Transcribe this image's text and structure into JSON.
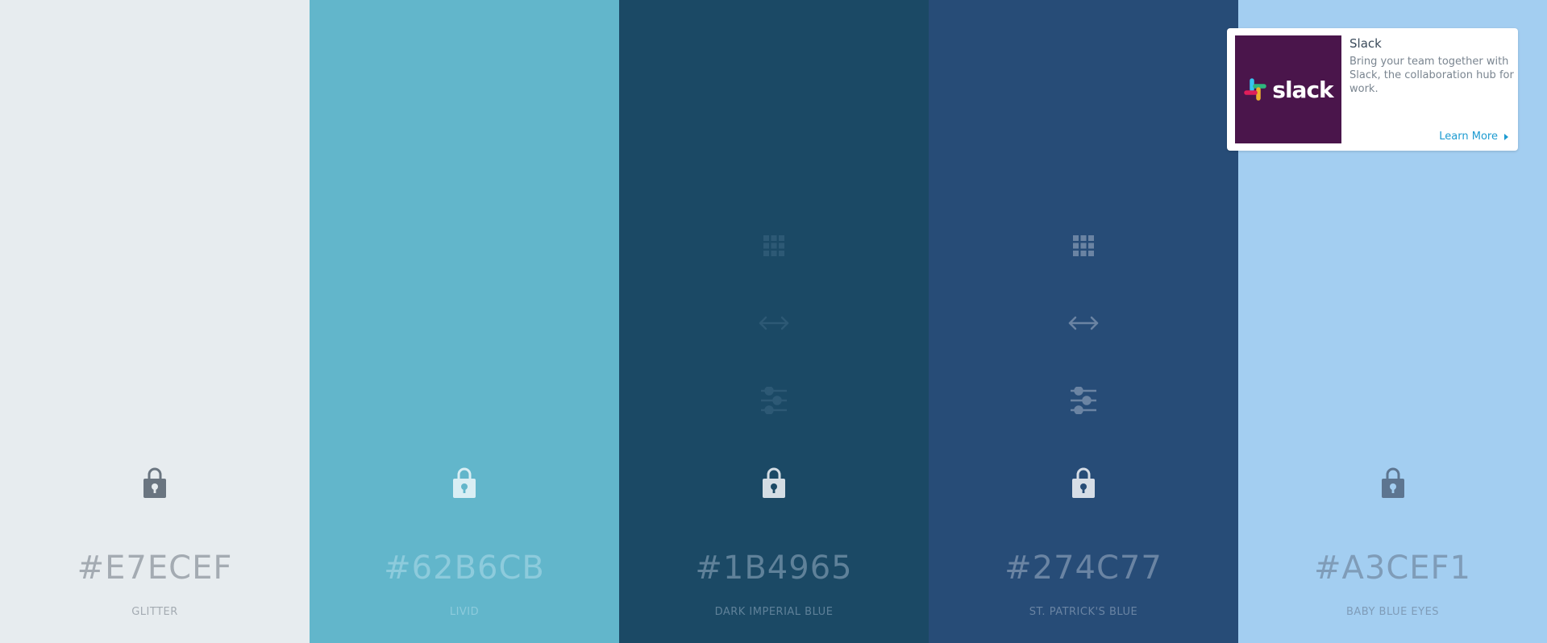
{
  "swatches": [
    {
      "hex": "#E7ECEF",
      "name": "GLITTER",
      "bg": "#e7ecef",
      "text_color": "#a4abb2",
      "lock_color": "#6a7580",
      "tools_visible": false
    },
    {
      "hex": "#62B6CB",
      "name": "LIVID",
      "bg": "#62b6cb",
      "text_color": "#8dcbdc",
      "lock_color": "#d9eef4",
      "tools_visible": false
    },
    {
      "hex": "#1B4965",
      "name": "DARK IMPERIAL BLUE",
      "bg": "#1b4965",
      "text_color": "#5f8199",
      "lock_color": "#d4dde4",
      "tools_visible": true,
      "tool_color": "#2d5975"
    },
    {
      "hex": "#274C77",
      "name": "ST. PATRICK'S BLUE",
      "bg": "#274c77",
      "text_color": "#6a84a3",
      "lock_color": "#d6dde6",
      "tools_visible": true,
      "tool_color": "#6b84a3"
    },
    {
      "hex": "#A3CEF1",
      "name": "BABY BLUE EYES",
      "bg": "#a3cef1",
      "text_color": "#7f9cb8",
      "lock_color": "#5d7590",
      "tools_visible": false
    }
  ],
  "icons": {
    "grid": "grid-icon",
    "drag": "drag-arrows-icon",
    "adjust": "adjust-sliders-icon",
    "lock": "lock-icon"
  },
  "ad": {
    "logo_text": "slack",
    "title": "Slack",
    "description": "Bring your team together with Slack, the collaboration hub for work.",
    "cta": "Learn More"
  }
}
